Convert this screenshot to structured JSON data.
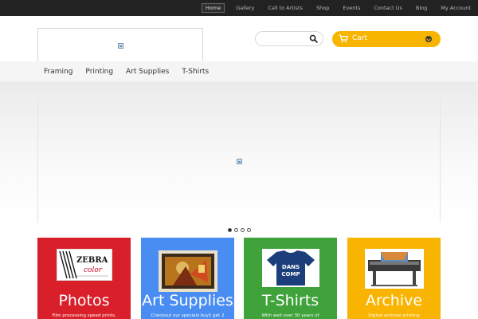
{
  "topnav": {
    "items": [
      "Home",
      "Gallery",
      "Call to Artists",
      "Shop",
      "Events",
      "Contact Us",
      "Blog",
      "My Account"
    ]
  },
  "header": {
    "search": {
      "placeholder": "",
      "value": ""
    },
    "cart": {
      "label": "Cart"
    }
  },
  "mainnav": {
    "items": [
      "Framing",
      "Printing",
      "Art Supplies",
      "T-Shirts"
    ]
  },
  "slider": {
    "dots": 4,
    "active_index": 0
  },
  "tiles": [
    {
      "title": "Photos",
      "sub": "Film processing speed prints,",
      "color": "#d9202a",
      "logo_text": "ZEBRA color"
    },
    {
      "title": "Art Supplies",
      "sub": "Checkout our specials buy1 get 2",
      "color": "#4a8df2"
    },
    {
      "title": "T-Shirts",
      "sub": "With well over 30 years of",
      "color": "#3fa23a",
      "shirt_text": "DANS COMP"
    },
    {
      "title": "Archive",
      "sub": "Digital archival printing",
      "color": "#f8b400"
    }
  ],
  "colors": {
    "topbar": "#222222",
    "cart": "#f7b500"
  }
}
